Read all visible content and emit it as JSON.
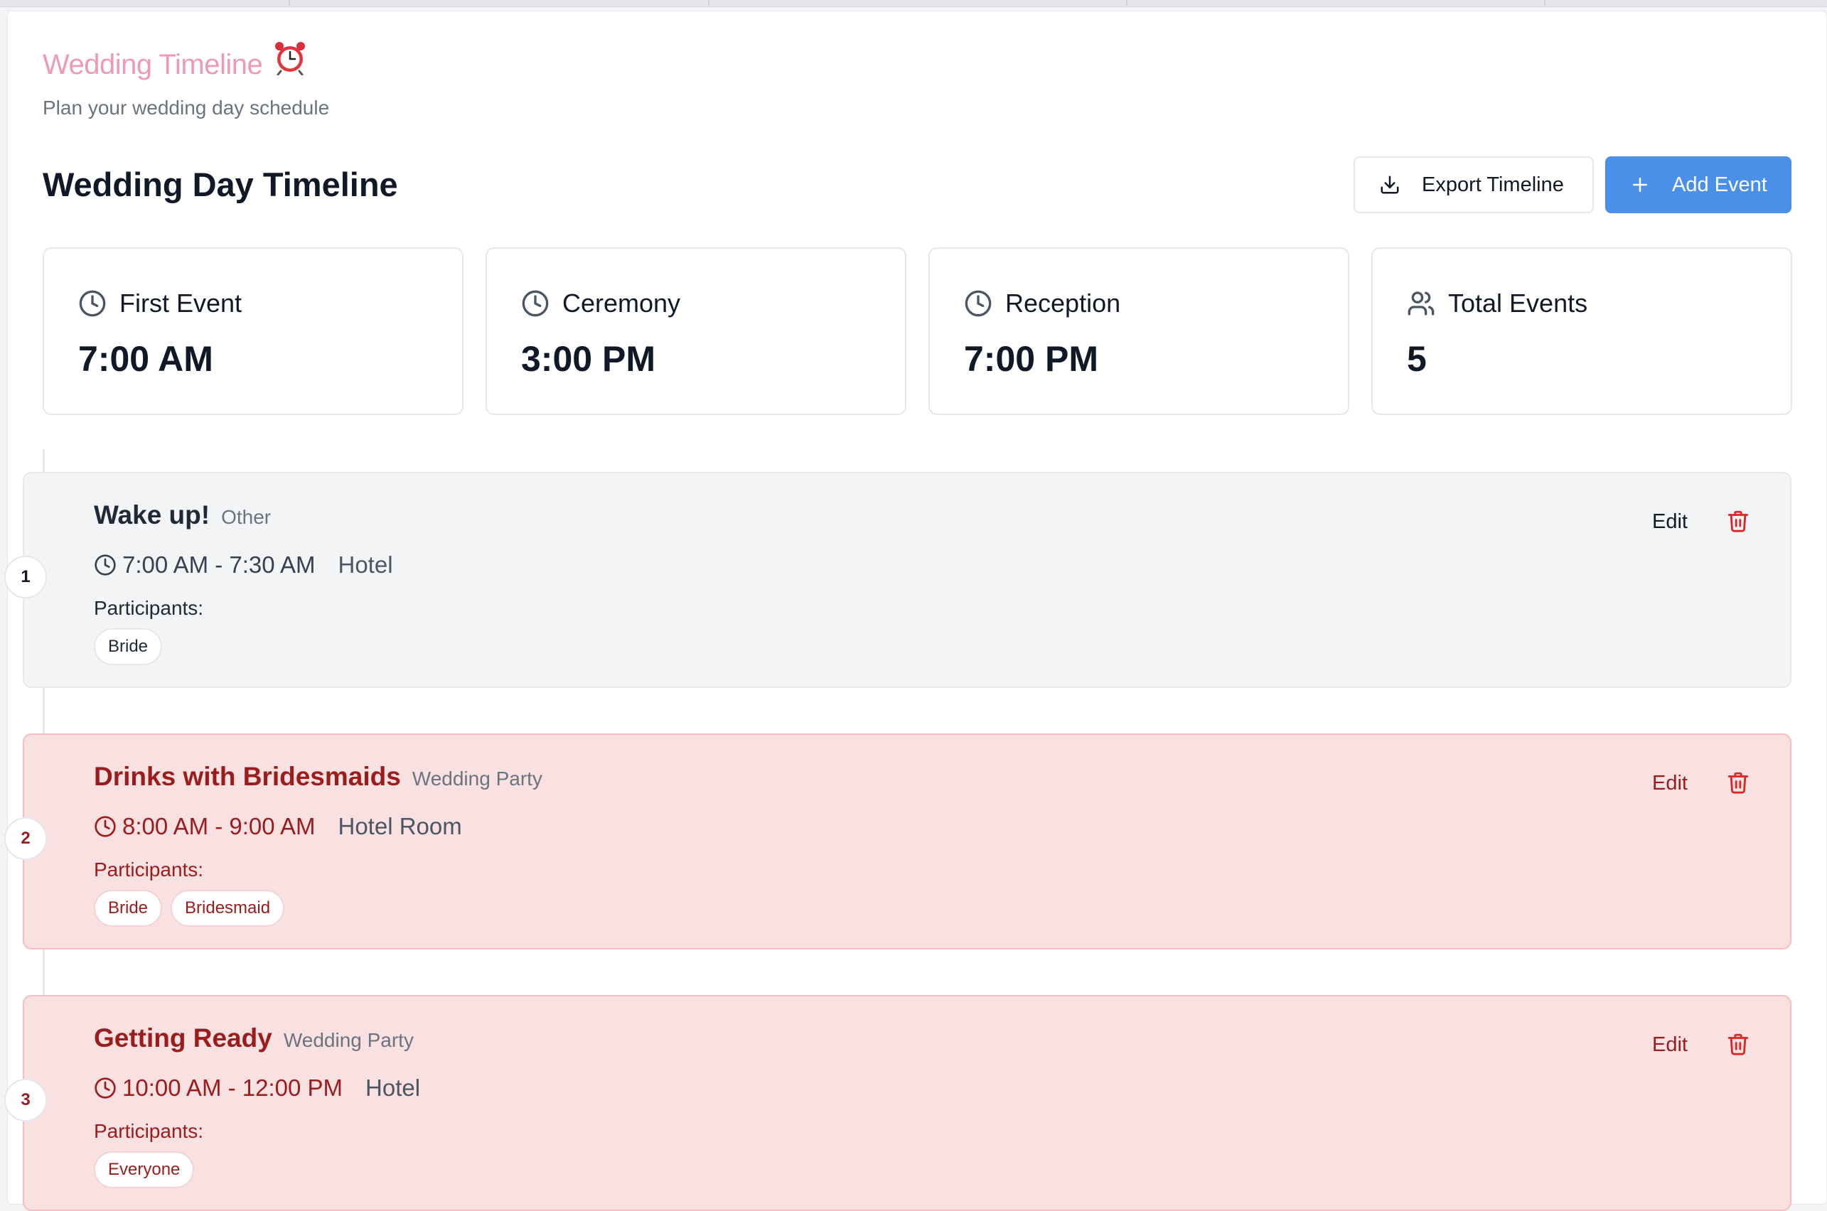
{
  "app": {
    "title": "Wedding Timeline",
    "subtitle": "Plan your wedding day schedule",
    "brand_icon": "alarm-clock-icon"
  },
  "header": {
    "page_title": "Wedding Day Timeline",
    "export_label": "Export Timeline",
    "add_label": "Add Event"
  },
  "stats": [
    {
      "label": "First Event",
      "value": "7:00 AM",
      "icon": "clock-icon"
    },
    {
      "label": "Ceremony",
      "value": "3:00 PM",
      "icon": "clock-icon"
    },
    {
      "label": "Reception",
      "value": "7:00 PM",
      "icon": "clock-icon"
    },
    {
      "label": "Total Events",
      "value": "5",
      "icon": "users-icon"
    }
  ],
  "events": [
    {
      "number": "1",
      "title": "Wake up!",
      "category": "Other",
      "time": "7:00 AM - 7:30 AM",
      "location": "Hotel",
      "participants_label": "Participants:",
      "participants": [
        "Bride"
      ],
      "edit_label": "Edit",
      "style": "gray"
    },
    {
      "number": "2",
      "title": "Drinks with Bridesmaids",
      "category": "Wedding Party",
      "time": "8:00 AM - 9:00 AM",
      "location": "Hotel Room",
      "participants_label": "Participants:",
      "participants": [
        "Bride",
        "Bridesmaid"
      ],
      "edit_label": "Edit",
      "style": "pink"
    },
    {
      "number": "3",
      "title": "Getting Ready",
      "category": "Wedding Party",
      "time": "10:00 AM - 12:00 PM",
      "location": "Hotel",
      "participants_label": "Participants:",
      "participants": [
        "Everyone"
      ],
      "edit_label": "Edit",
      "style": "pink"
    }
  ],
  "colors": {
    "brand": "#ec9ab8",
    "accent": "#4a90e8",
    "party_bg": "#f9e1e2",
    "party_text": "#9b1c1c",
    "delete": "#dc2626"
  }
}
